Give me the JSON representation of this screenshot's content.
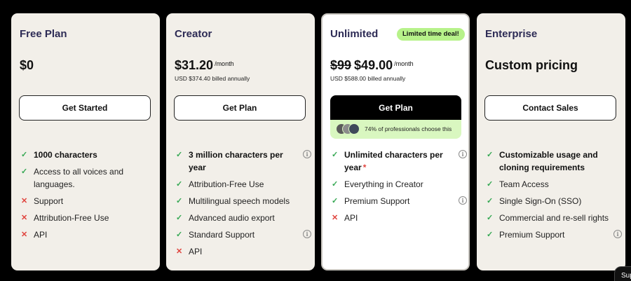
{
  "plans": [
    {
      "name": "Free Plan",
      "price": "$0",
      "cta": "Get Started",
      "features": [
        {
          "text": "1000 characters",
          "type": "check",
          "bold": true,
          "info": false
        },
        {
          "text": "Access to all voices and languages.",
          "type": "check",
          "bold": false,
          "info": false
        },
        {
          "text": "Support",
          "type": "cross",
          "bold": false,
          "info": false
        },
        {
          "text": "Attribution-Free Use",
          "type": "cross",
          "bold": false,
          "info": false
        },
        {
          "text": "API",
          "type": "cross",
          "bold": false,
          "info": false
        }
      ]
    },
    {
      "name": "Creator",
      "price": "$31.20",
      "per": "/month",
      "billed": "USD $374.40 billed annually",
      "cta": "Get Plan",
      "features": [
        {
          "text": "3 million characters per year",
          "type": "check",
          "bold": true,
          "info": true
        },
        {
          "text": "Attribution-Free Use",
          "type": "check",
          "bold": false,
          "info": false
        },
        {
          "text": "Multilingual speech models",
          "type": "check",
          "bold": false,
          "info": false
        },
        {
          "text": "Advanced audio export",
          "type": "check",
          "bold": false,
          "info": false
        },
        {
          "text": "Standard Support",
          "type": "check",
          "bold": false,
          "info": true
        },
        {
          "text": "API",
          "type": "cross",
          "bold": false,
          "info": false
        }
      ]
    },
    {
      "name": "Unlimited",
      "badge": "Limited time deal!",
      "old_price": "$99",
      "price": "$49.00",
      "per": "/month",
      "billed": "USD $588.00 billed annually",
      "cta": "Get Plan",
      "social_proof": "74% of professionals choose this",
      "features": [
        {
          "text": "Unlimited characters per year",
          "type": "check",
          "bold": true,
          "info": true,
          "asterisk": "*"
        },
        {
          "text": "Everything in Creator",
          "type": "check",
          "bold": false,
          "info": false
        },
        {
          "text": "Premium Support",
          "type": "check",
          "bold": false,
          "info": true
        },
        {
          "text": "API",
          "type": "cross",
          "bold": false,
          "info": false
        }
      ]
    },
    {
      "name": "Enterprise",
      "price": "Custom pricing",
      "cta": "Contact Sales",
      "features": [
        {
          "text": "Customizable usage and cloning requirements",
          "type": "check",
          "bold": true,
          "info": false
        },
        {
          "text": "Team Access",
          "type": "check",
          "bold": false,
          "info": false
        },
        {
          "text": "Single Sign-On (SSO)",
          "type": "check",
          "bold": false,
          "info": false
        },
        {
          "text": "Commercial and re-sell rights",
          "type": "check",
          "bold": false,
          "info": false
        },
        {
          "text": "Premium Support",
          "type": "check",
          "bold": false,
          "info": true
        }
      ]
    }
  ],
  "icons": {
    "check": "check-icon",
    "cross": "cross-icon",
    "info": "info-icon"
  },
  "support_button": "Sup",
  "colors": {
    "check": "#35a853",
    "cross": "#e0443e",
    "badge": "#b7f28a",
    "social_bg": "#d9f7c0",
    "card_bg": "#f2efe9"
  }
}
